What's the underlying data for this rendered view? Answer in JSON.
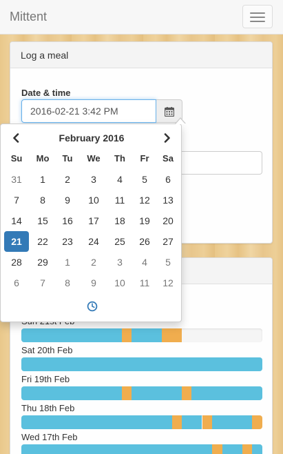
{
  "app": {
    "brand": "Mittent"
  },
  "meal_panel": {
    "heading": "Log a meal",
    "datetime_label": "Date & time",
    "datetime_value": "2016-02-21 3:42 PM"
  },
  "datepicker": {
    "month_title": "February 2016",
    "weekdays": [
      "Su",
      "Mo",
      "Tu",
      "We",
      "Th",
      "Fr",
      "Sa"
    ],
    "weeks": [
      [
        {
          "d": "31",
          "m": true
        },
        {
          "d": "1"
        },
        {
          "d": "2"
        },
        {
          "d": "3"
        },
        {
          "d": "4"
        },
        {
          "d": "5"
        },
        {
          "d": "6"
        }
      ],
      [
        {
          "d": "7"
        },
        {
          "d": "8"
        },
        {
          "d": "9"
        },
        {
          "d": "10"
        },
        {
          "d": "11"
        },
        {
          "d": "12"
        },
        {
          "d": "13"
        }
      ],
      [
        {
          "d": "14"
        },
        {
          "d": "15"
        },
        {
          "d": "16"
        },
        {
          "d": "17"
        },
        {
          "d": "18"
        },
        {
          "d": "19"
        },
        {
          "d": "20"
        }
      ],
      [
        {
          "d": "21",
          "a": true
        },
        {
          "d": "22"
        },
        {
          "d": "23"
        },
        {
          "d": "24"
        },
        {
          "d": "25"
        },
        {
          "d": "26"
        },
        {
          "d": "27"
        }
      ],
      [
        {
          "d": "28"
        },
        {
          "d": "29"
        },
        {
          "d": "1",
          "m": true
        },
        {
          "d": "2",
          "m": true
        },
        {
          "d": "3",
          "m": true
        },
        {
          "d": "4",
          "m": true
        },
        {
          "d": "5",
          "m": true
        }
      ],
      [
        {
          "d": "6",
          "m": true
        },
        {
          "d": "7",
          "m": true
        },
        {
          "d": "8",
          "m": true
        },
        {
          "d": "9",
          "m": true
        },
        {
          "d": "10",
          "m": true
        },
        {
          "d": "11",
          "m": true
        },
        {
          "d": "12",
          "m": true
        }
      ]
    ],
    "prev_icon": "chevron-left-icon",
    "next_icon": "chevron-right-icon",
    "time_icon": "clock-icon"
  },
  "colors": {
    "fasting": "#5bc0de",
    "eating": "#f0ad4e",
    "selected_day": "#337ab7",
    "focus_border": "#66afe9"
  },
  "history": {
    "days": [
      {
        "label": "Sun 21st Feb",
        "segments": [
          {
            "type": "fasting",
            "from": 0,
            "to": 0.418
          },
          {
            "type": "eating",
            "from": 0.418,
            "to": 0.458
          },
          {
            "type": "fasting",
            "from": 0.458,
            "to": 0.584
          },
          {
            "type": "eating",
            "from": 0.584,
            "to": 0.666
          }
        ]
      },
      {
        "label": "Sat 20th Feb",
        "segments": [
          {
            "type": "fasting",
            "from": 0,
            "to": 1
          }
        ]
      },
      {
        "label": "Fri 19th Feb",
        "segments": [
          {
            "type": "fasting",
            "from": 0,
            "to": 0.418
          },
          {
            "type": "eating",
            "from": 0.418,
            "to": 0.458
          },
          {
            "type": "fasting",
            "from": 0.458,
            "to": 0.666
          },
          {
            "type": "eating",
            "from": 0.666,
            "to": 0.706
          },
          {
            "type": "fasting",
            "from": 0.706,
            "to": 1
          }
        ]
      },
      {
        "label": "Thu 18th Feb",
        "segments": [
          {
            "type": "fasting",
            "from": 0,
            "to": 0.626
          },
          {
            "type": "eating",
            "from": 0.626,
            "to": 0.666
          },
          {
            "type": "fasting",
            "from": 0.666,
            "to": 0.75
          },
          {
            "type": "eating",
            "from": 0.75,
            "to": 0.79
          },
          {
            "type": "fasting",
            "from": 0.79,
            "to": 0.958
          },
          {
            "type": "eating",
            "from": 0.958,
            "to": 1
          }
        ]
      },
      {
        "label": "Wed 17th Feb",
        "segments": [
          {
            "type": "fasting",
            "from": 0,
            "to": 0.79
          },
          {
            "type": "eating",
            "from": 0.79,
            "to": 0.834
          },
          {
            "type": "fasting",
            "from": 0.834,
            "to": 0.916
          },
          {
            "type": "eating",
            "from": 0.916,
            "to": 0.958
          },
          {
            "type": "fasting",
            "from": 0.958,
            "to": 1
          }
        ]
      }
    ]
  }
}
